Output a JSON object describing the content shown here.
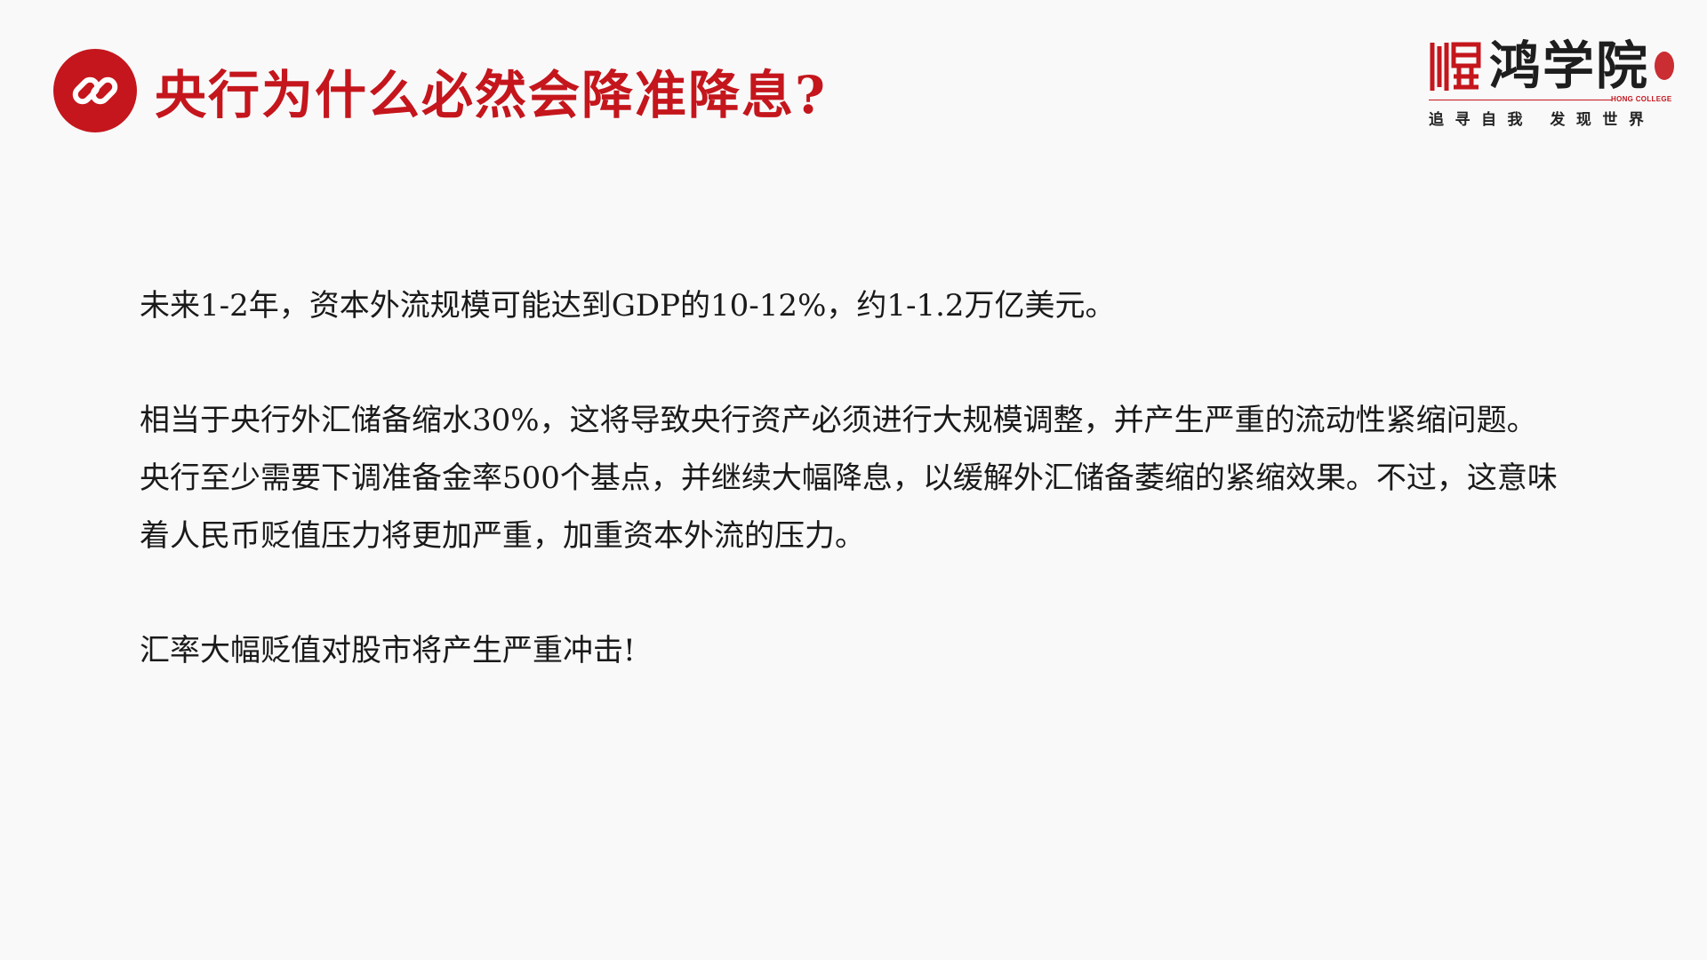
{
  "header": {
    "title": "央行为什么必然会降准降息?",
    "icon": "link-icon",
    "accent_color": "#c4161c"
  },
  "logo": {
    "name": "鸿学院",
    "english": "HONG COLLEGE",
    "slogan": "追寻自我 发现世界"
  },
  "content": {
    "paragraphs": [
      "未来1-2年，资本外流规模可能达到GDP的10-12%，约1-1.2万亿美元。",
      "相当于央行外汇储备缩水30%，这将导致央行资产必须进行大规模调整，并产生严重的流动性紧缩问题。央行至少需要下调准备金率500个基点，并继续大幅降息，以缓解外汇储备萎缩的紧缩效果。不过，这意味着人民币贬值压力将更加严重，加重资本外流的压力。",
      "汇率大幅贬值对股市将产生严重冲击!"
    ]
  }
}
